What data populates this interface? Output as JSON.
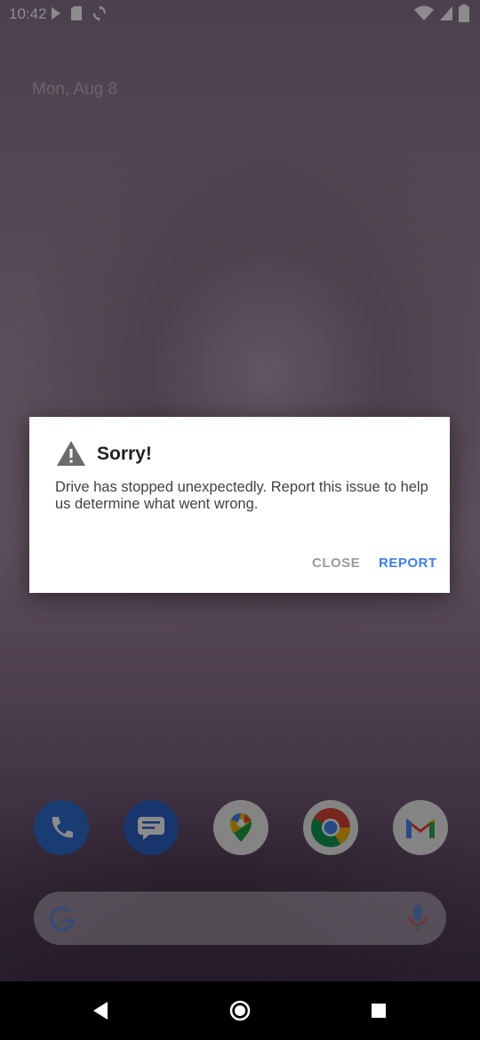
{
  "status_bar": {
    "time": "10:42",
    "left_icons": [
      "media-icon",
      "sd-card-icon",
      "sync-icon"
    ],
    "right_icons": [
      "wifi-icon",
      "signal-icon",
      "battery-icon"
    ]
  },
  "home": {
    "date": "Mon, Aug 8",
    "dock_apps": [
      "Phone",
      "Messages",
      "Maps",
      "Chrome",
      "Gmail"
    ],
    "search_icons": [
      "google-g-icon",
      "mic-icon"
    ]
  },
  "dialog": {
    "title": "Sorry!",
    "message": "Drive has stopped unexpectedly. Report this issue to help us determine what went wrong.",
    "close_label": "CLOSE",
    "report_label": "REPORT"
  },
  "nav_bar": {
    "icons": [
      "back-icon",
      "home-icon",
      "recents-icon"
    ]
  },
  "colors": {
    "accent": "#3f7fe0",
    "dialog_bg": "#ffffff",
    "nav_bg": "#000000"
  }
}
